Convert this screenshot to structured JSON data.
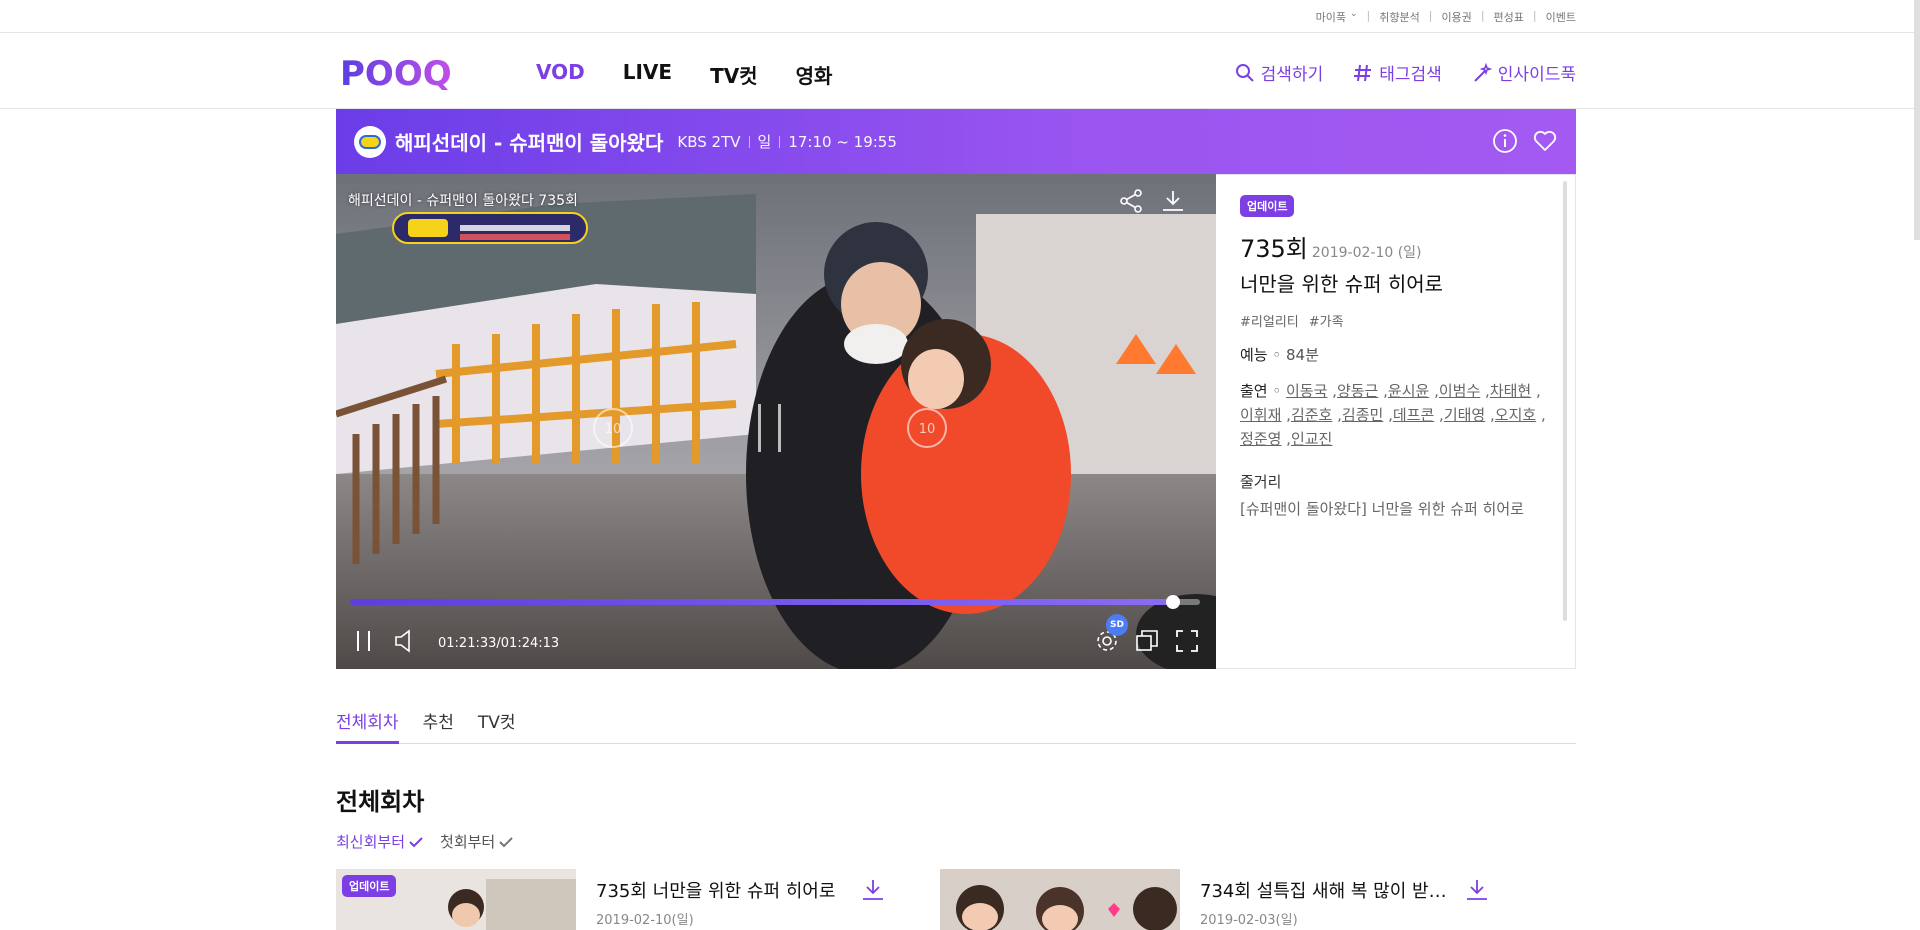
{
  "top_links": [
    "마이푹",
    "취향분석",
    "이용권",
    "편성표",
    "이벤트"
  ],
  "logo_text": "POOQ",
  "nav": [
    {
      "label": "VOD",
      "active": true
    },
    {
      "label": "LIVE",
      "active": false
    },
    {
      "label": "TV컷",
      "active": false
    },
    {
      "label": "영화",
      "active": false
    }
  ],
  "util": {
    "search": "검색하기",
    "tag_search": "태그검색",
    "inside": "인사이드푹"
  },
  "program": {
    "title": "해피선데이 - 슈퍼맨이 돌아왔다",
    "channel": "KBS 2TV",
    "day": "일",
    "time": "17:10 ~ 19:55"
  },
  "player": {
    "overlay_title": "해피선데이 - 슈퍼맨이 돌아왔다 735회",
    "current_time": "01:21:33",
    "total_time": "/01:24:13",
    "progress": 0.968,
    "quality": "SD",
    "skip_back": "10",
    "skip_forward": "10"
  },
  "episode": {
    "badge": "업데이트",
    "number": "735회",
    "date": "2019-02-10 (일)",
    "title": "너만을 위한 슈퍼 히어로",
    "tags": [
      "#리얼리티",
      "#가족"
    ],
    "genre_label": "예능",
    "genre_value": "84분",
    "cast_label": "출연",
    "cast": [
      "이동국",
      "양동근",
      "윤시윤",
      "이범수",
      "차태현",
      "이휘재",
      "김준호",
      "김종민",
      "데프콘",
      "기태영",
      "오지호",
      "정준영",
      "인교진"
    ],
    "summary_label": "줄거리",
    "summary": "[슈퍼맨이 돌아왔다] 너만을 위한 슈퍼 히어로"
  },
  "tabs": [
    {
      "label": "전체회차",
      "active": true
    },
    {
      "label": "추천",
      "active": false
    },
    {
      "label": "TV컷",
      "active": false
    }
  ],
  "section_title": "전체회차",
  "sort": [
    {
      "label": "최신회부터",
      "active": true
    },
    {
      "label": "첫회부터",
      "active": false
    }
  ],
  "episodes": [
    {
      "title": "735회 너만을 위한 슈퍼 히어로",
      "date": "2019-02-10(일)",
      "badge": "업데이트"
    },
    {
      "title": "734회 설특집 새해 복 많이 받으면...",
      "date": "2019-02-03(일)",
      "badge": ""
    }
  ],
  "colors": {
    "accent": "#7b3fe4",
    "banner_start": "#6b3de8",
    "banner_end": "#a45af2"
  }
}
